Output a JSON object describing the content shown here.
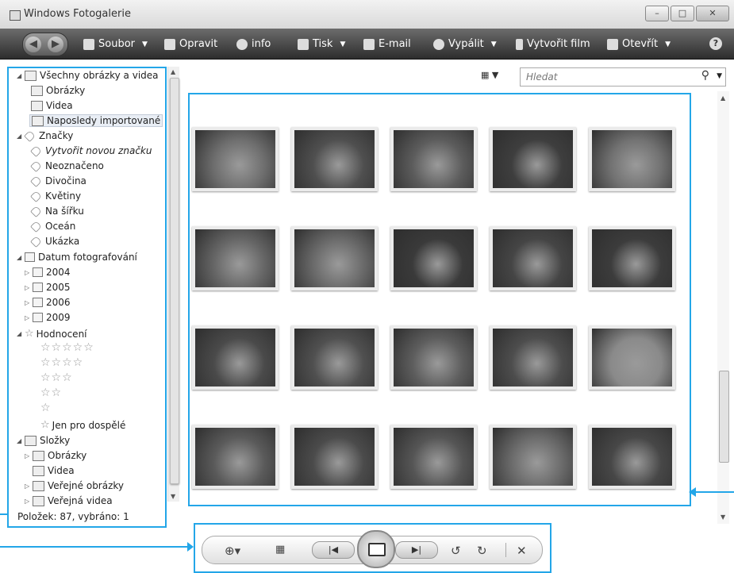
{
  "window": {
    "title": "Windows Fotogalerie"
  },
  "toolbar": {
    "items": [
      {
        "label": "Soubor",
        "icon": "document-icon",
        "dropdown": true
      },
      {
        "label": "Opravit",
        "icon": "fix-icon",
        "dropdown": false
      },
      {
        "label": "info",
        "icon": "info-tag-icon",
        "dropdown": false
      },
      {
        "label": "Tisk",
        "icon": "printer-icon",
        "dropdown": true
      },
      {
        "label": "E-mail",
        "icon": "email-icon",
        "dropdown": false
      },
      {
        "label": "Vypálit",
        "icon": "disc-icon",
        "dropdown": true
      },
      {
        "label": "Vytvořit film",
        "icon": "film-icon",
        "dropdown": false
      },
      {
        "label": "Otevřít",
        "icon": "open-icon",
        "dropdown": true
      }
    ],
    "help": "?"
  },
  "sidebar": {
    "all": "Všechny obrázky a videa",
    "pictures": "Obrázky",
    "videos": "Videa",
    "recent": "Naposledy importované",
    "tags": "Značky",
    "create_tag": "Vytvořit novou značku",
    "untagged": "Neoznačeno",
    "tag_items": [
      "Divočina",
      "Květiny",
      "Na šířku",
      "Oceán",
      "Ukázka"
    ],
    "date_taken": "Datum fotografování",
    "years": [
      "2004",
      "2005",
      "2006",
      "2009"
    ],
    "rating": "Hodnocení",
    "rating_rows": [
      "☆☆☆☆☆",
      "☆☆☆☆",
      "☆☆☆",
      "☆☆",
      "☆"
    ],
    "adults": "Jen pro dospělé",
    "folders": "Složky",
    "folder_items": [
      "Obrázky",
      "Videa",
      "Veřejné obrázky",
      "Veřejná videa"
    ],
    "status": "Položek: 87, vybráno: 1"
  },
  "search": {
    "placeholder": "Hledat"
  },
  "gallery": {
    "count": 20
  },
  "colors": {
    "callout": "#23a6e8",
    "toolbar": "#3a3a3a"
  }
}
